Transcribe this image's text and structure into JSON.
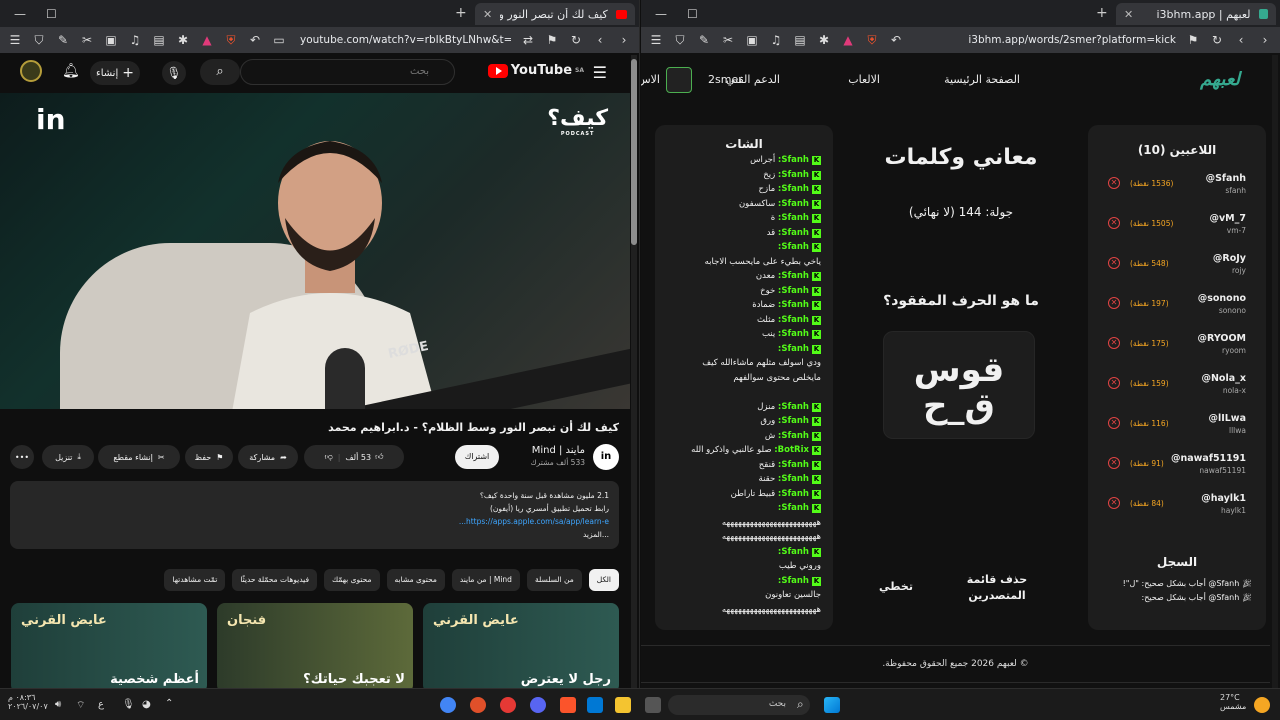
{
  "left_window": {
    "tab_title": "كيف لك أن تبصر النور وسط الظ",
    "url": "youtube.com/watch?v=rbIkBtyLNhw&t=1...",
    "youtube": {
      "logo": "YouTube",
      "logo_region": "SA",
      "search_placeholder": "بحث",
      "create_label": "إنشاء",
      "video_logo_right": "كيف؟",
      "video_logo_right_sub": "PODCAST",
      "video_logo_left": "in",
      "mic_brand": "RØDE",
      "title": "كيف لك أن تبصر النور وسط الظلام؟ - د.ابراهيم محمد",
      "channel_name": "مايند | Mind",
      "subscribers": "533 ألف مشترك",
      "subscribe_label": "اشتراك",
      "like_count": "53 ألف",
      "share_label": "مشاركة",
      "save_label": "حفظ",
      "clip_label": "إنشاء مقطع",
      "download_label": "تنزيل",
      "description": {
        "stats": "2.1 مليون مشاهدة  قبل سنة واحدة  كيف؟",
        "line2": "رابط تحميل تطبيق أمسري ريا (أيفون)",
        "link": "https://apps.apple.com/sa/app/learn-e...",
        "more": "...المزيد"
      },
      "chips": [
        "الكل",
        "من السلسلة",
        "من مايند | Mind",
        "محتوى مشابه",
        "محتوى بهمّك",
        "فيديوهات محمّلة حديثًا",
        "تمّت مشاهدتها"
      ],
      "thumbnails": [
        {
          "title": "رجل لا يعترض",
          "label": "عايض القرني"
        },
        {
          "title": "لا تعجبك حياتك؟",
          "label": "فنجان"
        },
        {
          "title": "أعظم شخصية",
          "label": "عايض القرني"
        }
      ]
    }
  },
  "right_window": {
    "tab_title": "لعبهم | i3bhm.app",
    "url": "i3bhm.app/words/2smer?platform=kick",
    "site": {
      "logo": "لعبهم",
      "nav": [
        "الصفحة الرئيسية",
        "الالعاب",
        "الدعم الفني",
        "الاس"
      ],
      "username": "2smer",
      "players_title": "اللاعبين (10)",
      "players": [
        {
          "name": "@Sfanh",
          "handle": "sfanh",
          "points": "(1536 نقطة)"
        },
        {
          "name": "@vM_7",
          "handle": "vm-7",
          "points": "(1505 نقطة)"
        },
        {
          "name": "@RoJy",
          "handle": "rojy",
          "points": "(548 نقطة)"
        },
        {
          "name": "@sonono",
          "handle": "sonono",
          "points": "(197 نقطة)"
        },
        {
          "name": "@RYOOM",
          "handle": "ryoom",
          "points": "(175 نقطة)"
        },
        {
          "name": "@Nola_x",
          "handle": "nola-x",
          "points": "(159 نقطة)"
        },
        {
          "name": "@lILwa",
          "handle": "lllwa",
          "points": "(116 نقطة)"
        },
        {
          "name": "@nawaf51191",
          "handle": "nawaf51191",
          "points": "(91 نقطة)"
        },
        {
          "name": "@haylk1",
          "handle": "haylk1",
          "points": "(84 نقطة)"
        }
      ],
      "game_title": "معاني وكلمات",
      "round": "جولة: 144 (لا نهائي)",
      "question": "ما هو الحرف المفقود؟",
      "word_line1": "قوس",
      "word_line2": "ق_ح",
      "clear_leaderboard": "حذف قائمة المتصدرين",
      "skip": "تخطي",
      "log_title": "السجل",
      "log": [
        "Sfanh@ أجاب بشكل صحيح: \"ل\"!",
        "Sfanh@ أجاب بشكل صحيح:"
      ],
      "chat_title": "الشات",
      "chat": [
        {
          "user": "Sfanh:",
          "text": "أجراس"
        },
        {
          "user": "Sfanh:",
          "text": "زيخ"
        },
        {
          "user": "Sfanh:",
          "text": "مازح"
        },
        {
          "user": "Sfanh:",
          "text": "ساكسفون"
        },
        {
          "user": "Sfanh:",
          "text": "ة"
        },
        {
          "user": "Sfanh:",
          "text": "قد"
        },
        {
          "user": "Sfanh:",
          "text": ""
        },
        {
          "user": "",
          "text": "ياخي بطيء على مايحسب الاجابه"
        },
        {
          "user": "Sfanh:",
          "text": "معدن"
        },
        {
          "user": "Sfanh:",
          "text": "خوخ"
        },
        {
          "user": "Sfanh:",
          "text": "ضمادة"
        },
        {
          "user": "Sfanh:",
          "text": "مثلث"
        },
        {
          "user": "Sfanh:",
          "text": "ينب"
        },
        {
          "user": "Sfanh:",
          "text": ""
        },
        {
          "user": "",
          "text": "ودي اسولف مثلهم ماشاءالله كيف"
        },
        {
          "user": "",
          "text": "مايخلص محتوى سوالفهم"
        },
        {
          "user": "",
          "text": ""
        },
        {
          "user": "Sfanh:",
          "text": "منزل"
        },
        {
          "user": "Sfanh:",
          "text": "ورق"
        },
        {
          "user": "Sfanh:",
          "text": "ش"
        },
        {
          "user": "BotRix:",
          "text": "صلو عالنبي واذكرو الله"
        },
        {
          "user": "Sfanh:",
          "text": "قنقح"
        },
        {
          "user": "Sfanh:",
          "text": "حقنة"
        },
        {
          "user": "Sfanh:",
          "text": "قبيط تاراطن"
        },
        {
          "user": "Sfanh:",
          "text": ""
        },
        {
          "user": "",
          "text": "ههههههههههههههههههههههههه"
        },
        {
          "user": "",
          "text": "ههههههههههههههههههههههههه"
        },
        {
          "user": "Sfanh:",
          "text": ""
        },
        {
          "user": "",
          "text": "وروني طيب"
        },
        {
          "user": "Sfanh:",
          "text": ""
        },
        {
          "user": "",
          "text": "جالسين تعاونون"
        },
        {
          "user": "",
          "text": "ههههههههههههههههههههههههه"
        }
      ],
      "footer": "© لعبهم 2026 جميع الحقوق محفوظة."
    }
  },
  "taskbar": {
    "search_placeholder": "بحث",
    "weather_temp": "27°C",
    "weather_desc": "مشمس",
    "time": "٠٨:٣٦ م",
    "date": "٢٠٢٦/٠٧/٠٧",
    "lang": "ع"
  },
  "colors": {
    "kick_green": "#53fc18",
    "points_orange": "#f5a623",
    "remove_red": "#e04444",
    "brand_teal": "#35a98f",
    "yt_red": "#ff0000"
  }
}
